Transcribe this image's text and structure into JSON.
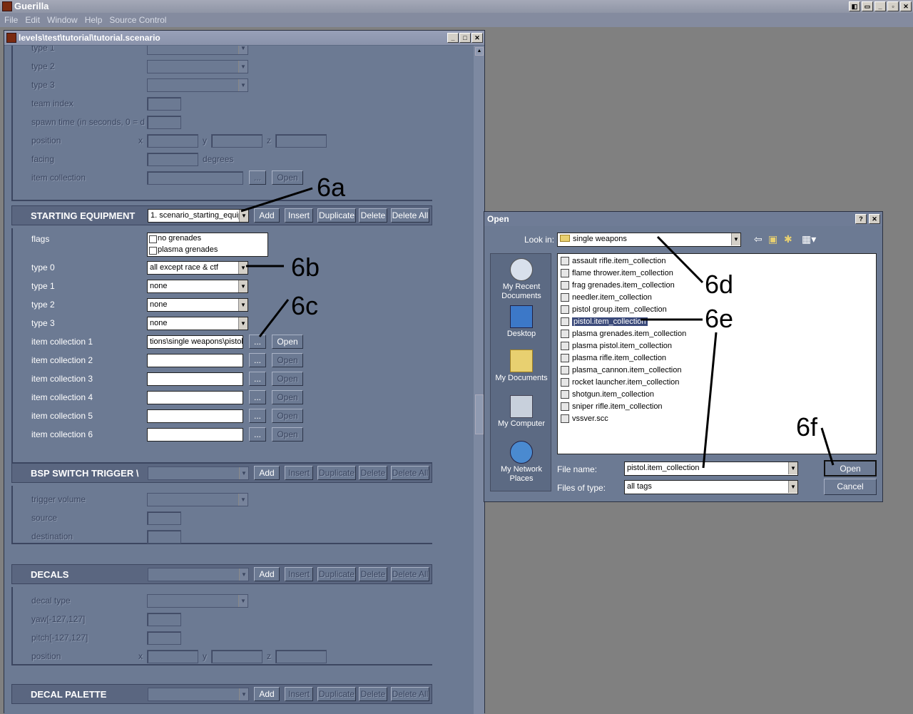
{
  "app": {
    "title": "Guerilla",
    "window_buttons": [
      "◧",
      "▭",
      "_",
      "▫",
      "✕"
    ]
  },
  "menu": [
    "File",
    "Edit",
    "Window",
    "Help",
    "Source Control"
  ],
  "child": {
    "title": "levels\\test\\tutorial\\tutorial.scenario",
    "buttons": [
      "_",
      "□",
      "✕"
    ]
  },
  "top_section": {
    "rows": [
      {
        "label": "type 1"
      },
      {
        "label": "type 2"
      },
      {
        "label": "type 3"
      },
      {
        "label": "team index"
      },
      {
        "label": "spawn time (in seconds, 0 = d"
      },
      {
        "label": "position",
        "x": "x",
        "y": "y",
        "z": "z"
      },
      {
        "label": "facing",
        "units": "degrees"
      },
      {
        "label": "item collection",
        "browse": "...",
        "open": "Open"
      }
    ]
  },
  "starting_equipment": {
    "title": "STARTING EQUIPMENT",
    "selector": "1. scenario_starting_equip",
    "buttons": [
      "Add",
      "Insert",
      "Duplicate",
      "Delete",
      "Delete All"
    ],
    "flags_label": "flags",
    "flags": [
      "no grenades",
      "plasma grenades"
    ],
    "types": [
      {
        "label": "type 0",
        "value": "all except race & ctf"
      },
      {
        "label": "type 1",
        "value": "none"
      },
      {
        "label": "type 2",
        "value": "none"
      },
      {
        "label": "type 3",
        "value": "none"
      }
    ],
    "collections": [
      {
        "label": "item collection 1",
        "value": "tions\\single weapons\\pistol"
      },
      {
        "label": "item collection 2",
        "value": ""
      },
      {
        "label": "item collection 3",
        "value": ""
      },
      {
        "label": "item collection 4",
        "value": ""
      },
      {
        "label": "item collection 5",
        "value": ""
      },
      {
        "label": "item collection 6",
        "value": ""
      }
    ],
    "browse": "...",
    "open": "Open"
  },
  "bsp": {
    "title": "BSP SWITCH TRIGGER \\",
    "rows": [
      "trigger volume",
      "source",
      "destination"
    ]
  },
  "decals": {
    "title": "DECALS",
    "rows": [
      "decal type",
      "yaw[-127,127]",
      "pitch[-127,127]",
      "position"
    ],
    "x": "x",
    "y": "y",
    "z": "z"
  },
  "decal_palette": {
    "title": "DECAL PALETTE"
  },
  "section_buttons": [
    "Add",
    "Insert",
    "Duplicate",
    "Delete",
    "Delete All"
  ],
  "dialog": {
    "title": "Open",
    "help": "?",
    "close": "✕",
    "look_in_label": "Look in:",
    "look_in_value": "single weapons",
    "places": [
      "My Recent\nDocuments",
      "Desktop",
      "My Documents",
      "My Computer",
      "My Network\nPlaces"
    ],
    "files": [
      "assault rifle.item_collection",
      "flame thrower.item_collection",
      "frag grenades.item_collection",
      "needler.item_collection",
      "pistol group.item_collection",
      "pistol.item_collection",
      "plasma grenades.item_collection",
      "plasma pistol.item_collection",
      "plasma rifle.item_collection",
      "plasma_cannon.item_collection",
      "rocket launcher.item_collection",
      "shotgun.item_collection",
      "sniper rifle.item_collection",
      "vssver.scc"
    ],
    "selected_index": 5,
    "filename_label": "File name:",
    "filename_value": "pistol.item_collection",
    "filetype_label": "Files of type:",
    "filetype_value": "all tags",
    "open_button": "Open",
    "cancel_button": "Cancel"
  },
  "annotations": [
    "6a",
    "6b",
    "6c",
    "6d",
    "6e",
    "6f"
  ]
}
